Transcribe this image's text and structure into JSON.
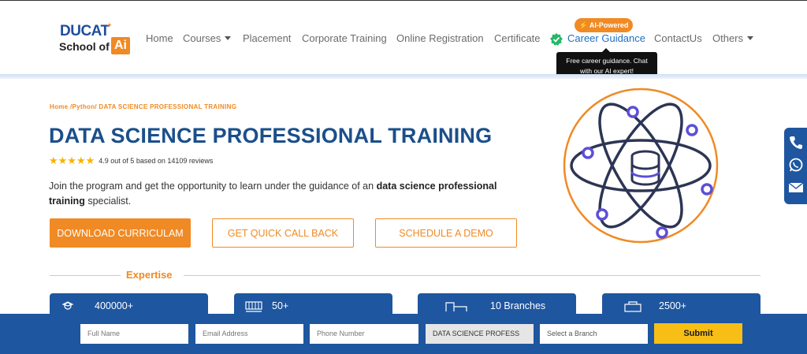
{
  "brand": {
    "name": "DUCAT",
    "tagline": "School of",
    "ai_mark": "Ai",
    "accent_color": "#f08a24",
    "primary_color": "#1e56a0"
  },
  "nav": {
    "items": [
      {
        "label": "Home"
      },
      {
        "label": "Courses"
      },
      {
        "label": "Placement"
      },
      {
        "label": "Corporate Training"
      },
      {
        "label": "Online Registration"
      },
      {
        "label": "Certificate"
      },
      {
        "label": "Career Guidance"
      },
      {
        "label": "ContactUs"
      },
      {
        "label": "Others"
      }
    ],
    "ai_badge": "⚡ AI-Powered",
    "tooltip_line1": "Free career guidance. Chat",
    "tooltip_line2": "with our AI expert!"
  },
  "hero": {
    "breadcrumb": "Home /Python/ DATA SCIENCE PROFESSIONAL TRAINING",
    "title": "DATA SCIENCE PROFESSIONAL TRAINING",
    "stars": "★★★★★",
    "rating_text": "4.9 out of 5 based on 14109 reviews",
    "intro_start": "Join the program and get the opportunity to learn under the guidance of an ",
    "intro_bold": "data science professional training",
    "intro_end": " specialist.",
    "buttons": {
      "download": "DOWNLOAD CURRICULAM",
      "callback": "GET QUICK CALL BACK",
      "demo": "SCHEDULE A DEMO"
    }
  },
  "expertise": {
    "label": "Expertise",
    "cards": [
      {
        "value": "400000+",
        "icon": "graduate-icon"
      },
      {
        "value": "50+",
        "icon": "classroom-icon"
      },
      {
        "value": "10 Branches",
        "icon": "building-icon"
      },
      {
        "value": "2500+",
        "icon": "people-icon"
      }
    ]
  },
  "floating": {
    "icons": [
      "phone-icon",
      "whatsapp-icon",
      "email-icon"
    ]
  },
  "form": {
    "full_name": "Full Name",
    "email": "Email Address",
    "phone": "Phone Number",
    "course": "DATA SCIENCE PROFESS",
    "branch": "Select a Branch",
    "submit": "Submit"
  }
}
